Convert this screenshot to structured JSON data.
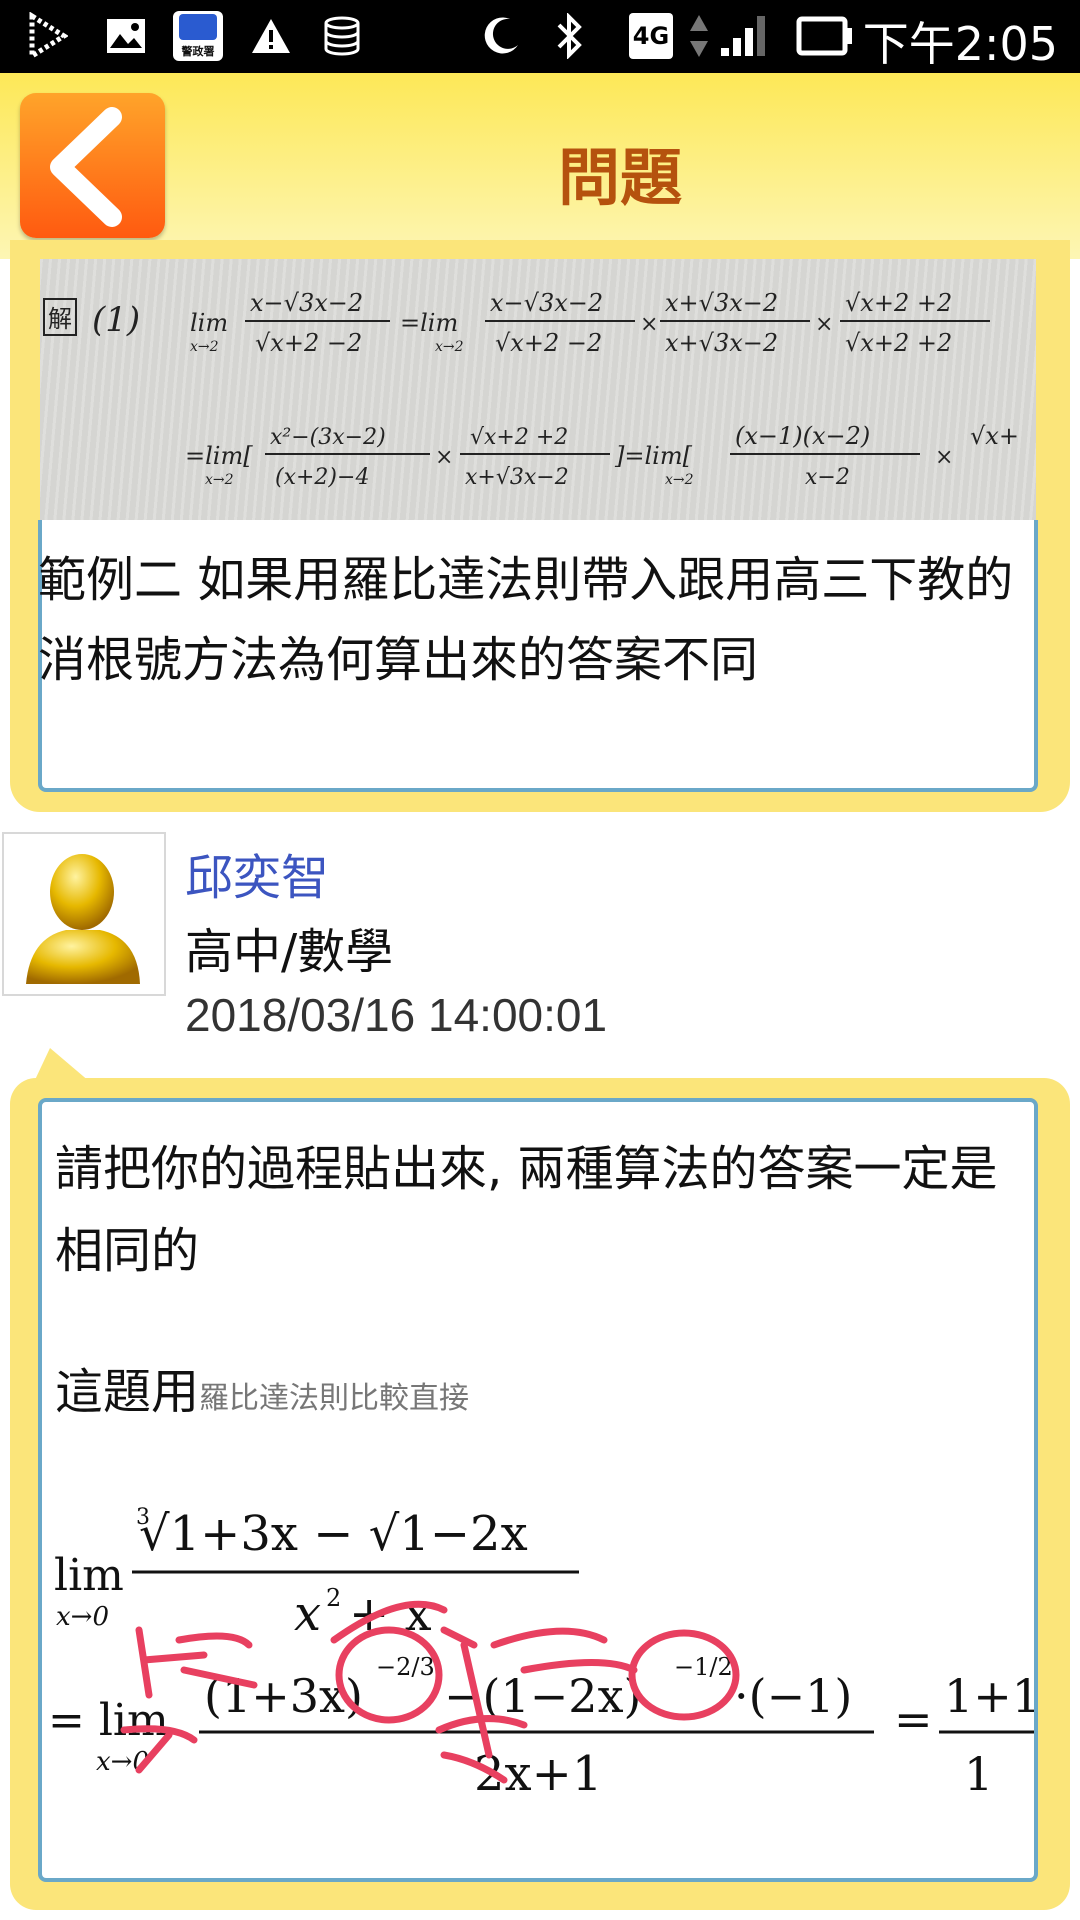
{
  "status_bar": {
    "time": "下午2:05",
    "network": "4G",
    "app_badge": "警政署",
    "icons": [
      "play-store-icon",
      "image-icon",
      "police-app-icon",
      "warning-icon",
      "database-icon",
      "moon-icon",
      "bluetooth-icon",
      "network-4g-icon",
      "signal-icon",
      "battery-icon"
    ]
  },
  "header": {
    "title": "問題",
    "back_icon": "chevron-left-icon"
  },
  "question": {
    "text": "範例二 如果用羅比達法則帶入跟用高三下教的消根號方法為何算出來的答案不同"
  },
  "answer": {
    "author": "邱奕智",
    "subject": "高中/數學",
    "timestamp": "2018/03/16 14:00:01",
    "text1": "請把你的過程貼出來, 兩種算法的答案一定是相同的",
    "text2_main": "這題用",
    "text2_small": "羅比達法則比較直接"
  },
  "colors": {
    "bubble": "#fbe57a",
    "bubble_border": "#6aa8c8",
    "title": "#b5520e",
    "author": "#3c55c0",
    "back_button": "#ff7a1a"
  }
}
